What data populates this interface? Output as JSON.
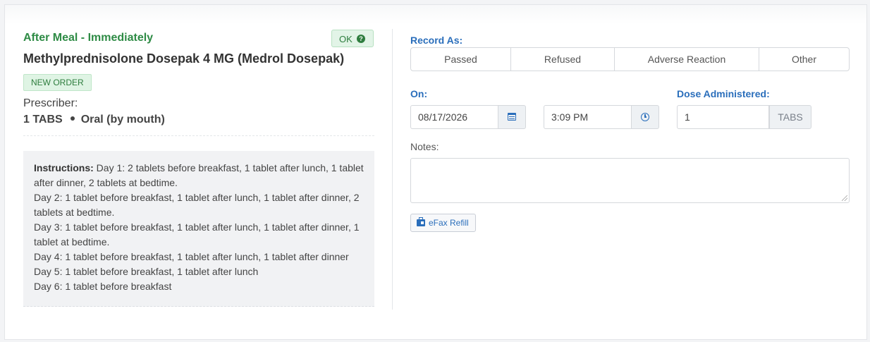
{
  "left": {
    "timing": "After Meal - Immediately",
    "status_badge": "OK",
    "status_icon": "question-circle-icon",
    "med_name": "Methylprednisolone Dosepak 4 MG (Medrol Dosepak)",
    "order_badge": "NEW ORDER",
    "prescriber_label": "Prescriber:",
    "dose": "1 TABS",
    "route": "Oral (by mouth)",
    "instructions_label": "Instructions:",
    "instructions_lines": [
      "Day 1: 2 tablets before breakfast, 1 tablet after lunch, 1 tablet after dinner, 2 tablets at bedtime.",
      "Day 2: 1 tablet before breakfast, 1 tablet after lunch, 1 tablet after dinner, 2 tablets at bedtime.",
      "Day 3: 1 tablet before breakfast, 1 tablet after lunch, 1 tablet after dinner, 1 tablet at bedtime.",
      "Day 4: 1 tablet before breakfast, 1 tablet after lunch, 1 tablet after dinner",
      "Day 5: 1 tablet before breakfast, 1 tablet after lunch",
      "Day 6: 1 tablet before breakfast"
    ]
  },
  "right": {
    "record_as_label": "Record As:",
    "record_options": [
      "Passed",
      "Refused",
      "Adverse Reaction",
      "Other"
    ],
    "on_label": "On:",
    "date_value": "08/17/2026",
    "date_icon": "calendar-icon",
    "time_value": "3:09 PM",
    "time_icon": "clock-icon",
    "dose_label": "Dose Administered:",
    "dose_value": "1",
    "dose_unit": "TABS",
    "notes_label": "Notes:",
    "notes_value": "",
    "efax_label": "eFax Refill",
    "efax_icon": "fax-icon"
  },
  "colors": {
    "green_text": "#2e8b45",
    "blue_label": "#2a6ebb",
    "instructions_bg": "#f1f2f4"
  }
}
